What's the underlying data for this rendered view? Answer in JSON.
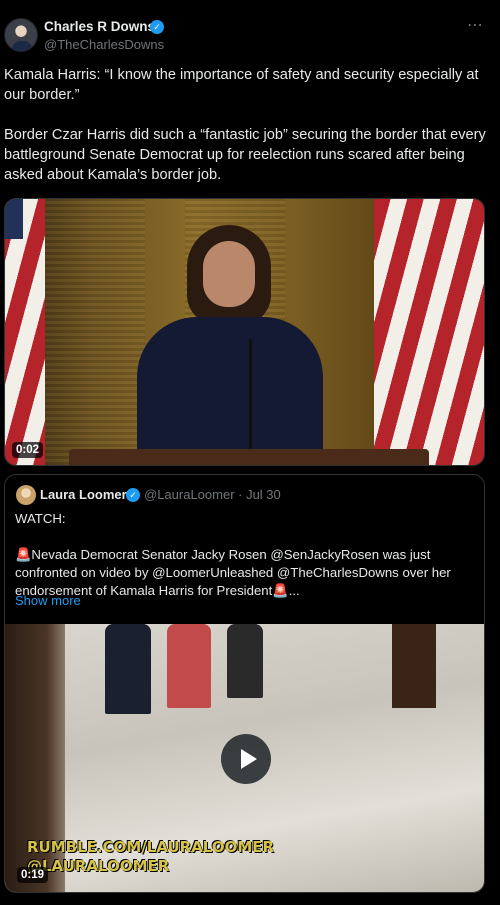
{
  "author": {
    "name": "Charles R Downs",
    "handle": "@TheCharlesDowns",
    "verified_icon": "verified-badge-icon"
  },
  "more_icon": "⋯",
  "tweet": {
    "text": "Kamala Harris: “I know the importance of safety and security especially at our border.”\n\nBorder Czar Harris did such a “fantastic job” securing the border that every battleground Senate Democrat up for reelection runs scared after being asked about Kamala’s border job.",
    "video_duration": "0:02"
  },
  "quote": {
    "name": "Laura Loomer",
    "handle_date": "@LauraLoomer · Jul 30",
    "text": "WATCH:\n\n🚨Nevada Democrat Senator Jacky Rosen @SenJackyRosen was just confronted on video by @LoomerUnleashed @TheCharlesDowns over her endorsement of Kamala Harris for President🚨...",
    "show_more": "Show more",
    "video_duration": "0:19",
    "watermark_line1": "RUMBLE.COM/LAURALOOMER",
    "watermark_line2": "@LAURALOOMER"
  },
  "colors": {
    "background": "#000000",
    "text": "#e7e9ea",
    "muted": "#71767b",
    "link": "#1d9bf0",
    "verified": "#1d9bf0"
  }
}
